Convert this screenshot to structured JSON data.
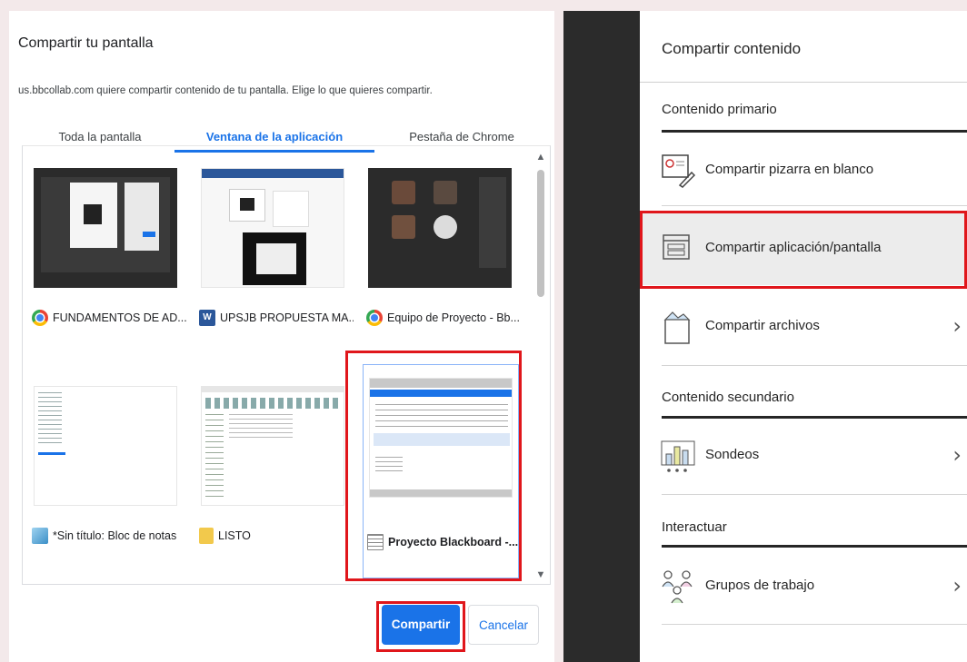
{
  "dialog": {
    "title": "Compartir tu pantalla",
    "description": "us.bbcollab.com quiere compartir contenido de tu pantalla. Elige lo que quieres compartir.",
    "tabs": [
      {
        "label": "Toda la pantalla",
        "active": false
      },
      {
        "label": "Ventana de la aplicación",
        "active": true
      },
      {
        "label": "Pestaña de Chrome",
        "active": false
      }
    ],
    "windows": [
      {
        "label": "FUNDAMENTOS DE AD...",
        "icon": "chrome-icon"
      },
      {
        "label": "UPSJB PROPUESTA MA...",
        "icon": "word-icon"
      },
      {
        "label": "Equipo de Proyecto - Bb...",
        "icon": "chrome-icon"
      },
      {
        "label": "*Sin título: Bloc de notas",
        "icon": "notepad-icon"
      },
      {
        "label": "LISTO",
        "icon": "folder-icon"
      },
      {
        "label": "Proyecto Blackboard -...",
        "icon": "blackboard-icon",
        "selected": true
      }
    ],
    "share_label": "Compartir",
    "cancel_label": "Cancelar"
  },
  "panel": {
    "title": "Compartir contenido",
    "sections": [
      {
        "title": "Contenido primario",
        "items": [
          {
            "label": "Compartir pizarra en blanco",
            "icon": "whiteboard-icon",
            "chevron": false
          },
          {
            "label": "Compartir aplicación/pantalla",
            "icon": "app-screen-icon",
            "chevron": false,
            "highlighted": true
          },
          {
            "label": "Compartir archivos",
            "icon": "files-icon",
            "chevron": true
          }
        ]
      },
      {
        "title": "Contenido secundario",
        "items": [
          {
            "label": "Sondeos",
            "icon": "polls-icon",
            "chevron": true
          }
        ]
      },
      {
        "title": "Interactuar",
        "items": [
          {
            "label": "Grupos de trabajo",
            "icon": "breakout-groups-icon",
            "chevron": true
          }
        ]
      }
    ],
    "chevron_glyph": "›"
  },
  "colors": {
    "accent": "#1a73e8",
    "highlight_frame": "#e0161b",
    "dark_strip": "#2b2b2b"
  }
}
